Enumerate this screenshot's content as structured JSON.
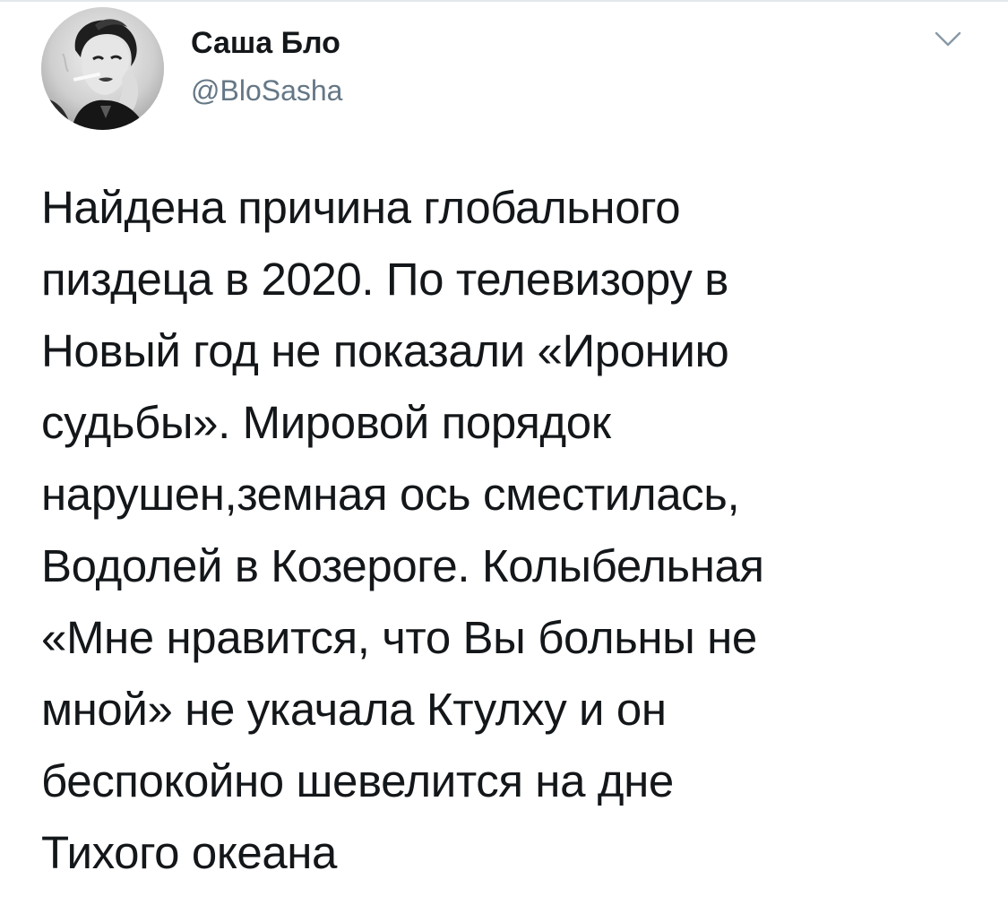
{
  "author": {
    "display_name": "Саша Бло",
    "handle": "@BloSasha",
    "avatar_icon": "profile-photo"
  },
  "menu": {
    "icon": "chevron-down-icon"
  },
  "tweet": {
    "lines": [
      "Найдена причина глобального",
      "пиздеца в 2020. По телевизору в",
      "Новый год не показали «Иронию",
      "судьбы». Мировой порядок",
      "нарушен,земная ось сместилась,",
      "Водолей в Козероге. Колыбельная",
      "«Мне нравится, что Вы больны не",
      "мной» не укачала Ктулху и он",
      "беспокойно шевелится на дне",
      "Тихого океана"
    ]
  },
  "colors": {
    "text": "#14171a",
    "secondary_text": "#657786",
    "caret": "#8899a6",
    "divider": "#e1e8ed"
  }
}
